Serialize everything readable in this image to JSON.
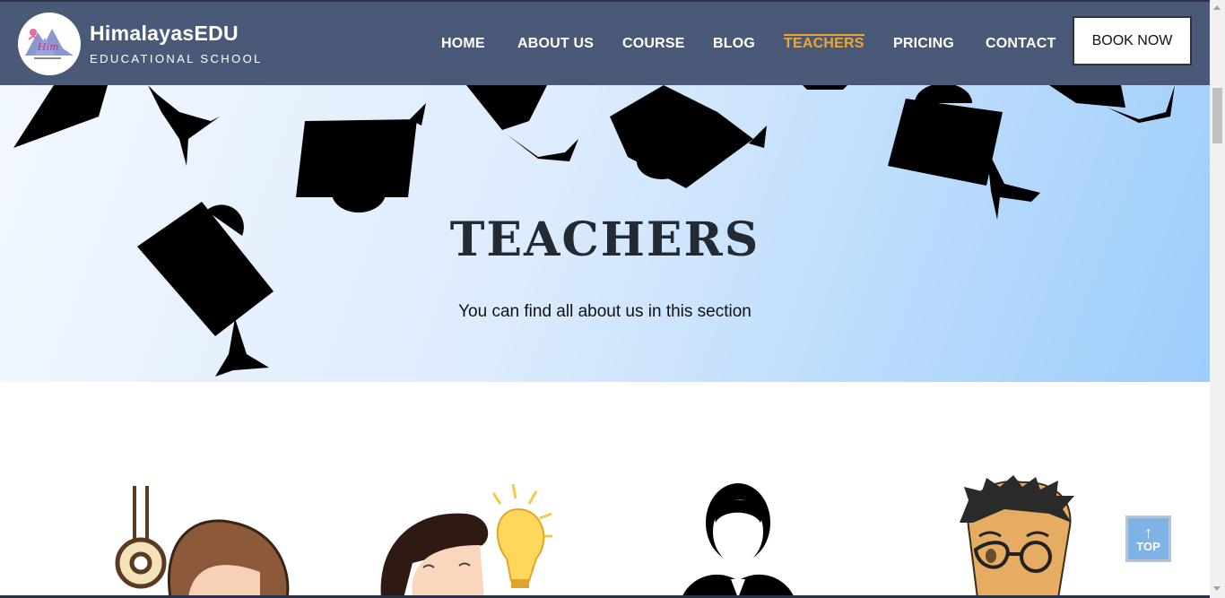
{
  "brand": {
    "name": "HimalayasEDU",
    "subtitle": "EDUCATIONAL SCHOOL"
  },
  "nav": {
    "items": [
      {
        "label": "HOME"
      },
      {
        "label": "ABOUT US"
      },
      {
        "label": "COURSE"
      },
      {
        "label": "BLOG"
      },
      {
        "label": "TEACHERS"
      },
      {
        "label": "PRICING"
      },
      {
        "label": "CONTACT"
      }
    ],
    "active": "TEACHERS",
    "book_label": "BOOK NOW"
  },
  "hero": {
    "title": "TEACHERS",
    "subtitle": "You can find all about us in this section"
  },
  "top_button": {
    "label": "TOP",
    "icon": "arrow-up-icon"
  },
  "colors": {
    "navbar": "#4b5979",
    "accent": "#f0a52b",
    "hero_start": "#f3f8ff",
    "hero_end": "#9ccdfb",
    "title": "#232a33",
    "top_button": "#7fb3e6"
  }
}
